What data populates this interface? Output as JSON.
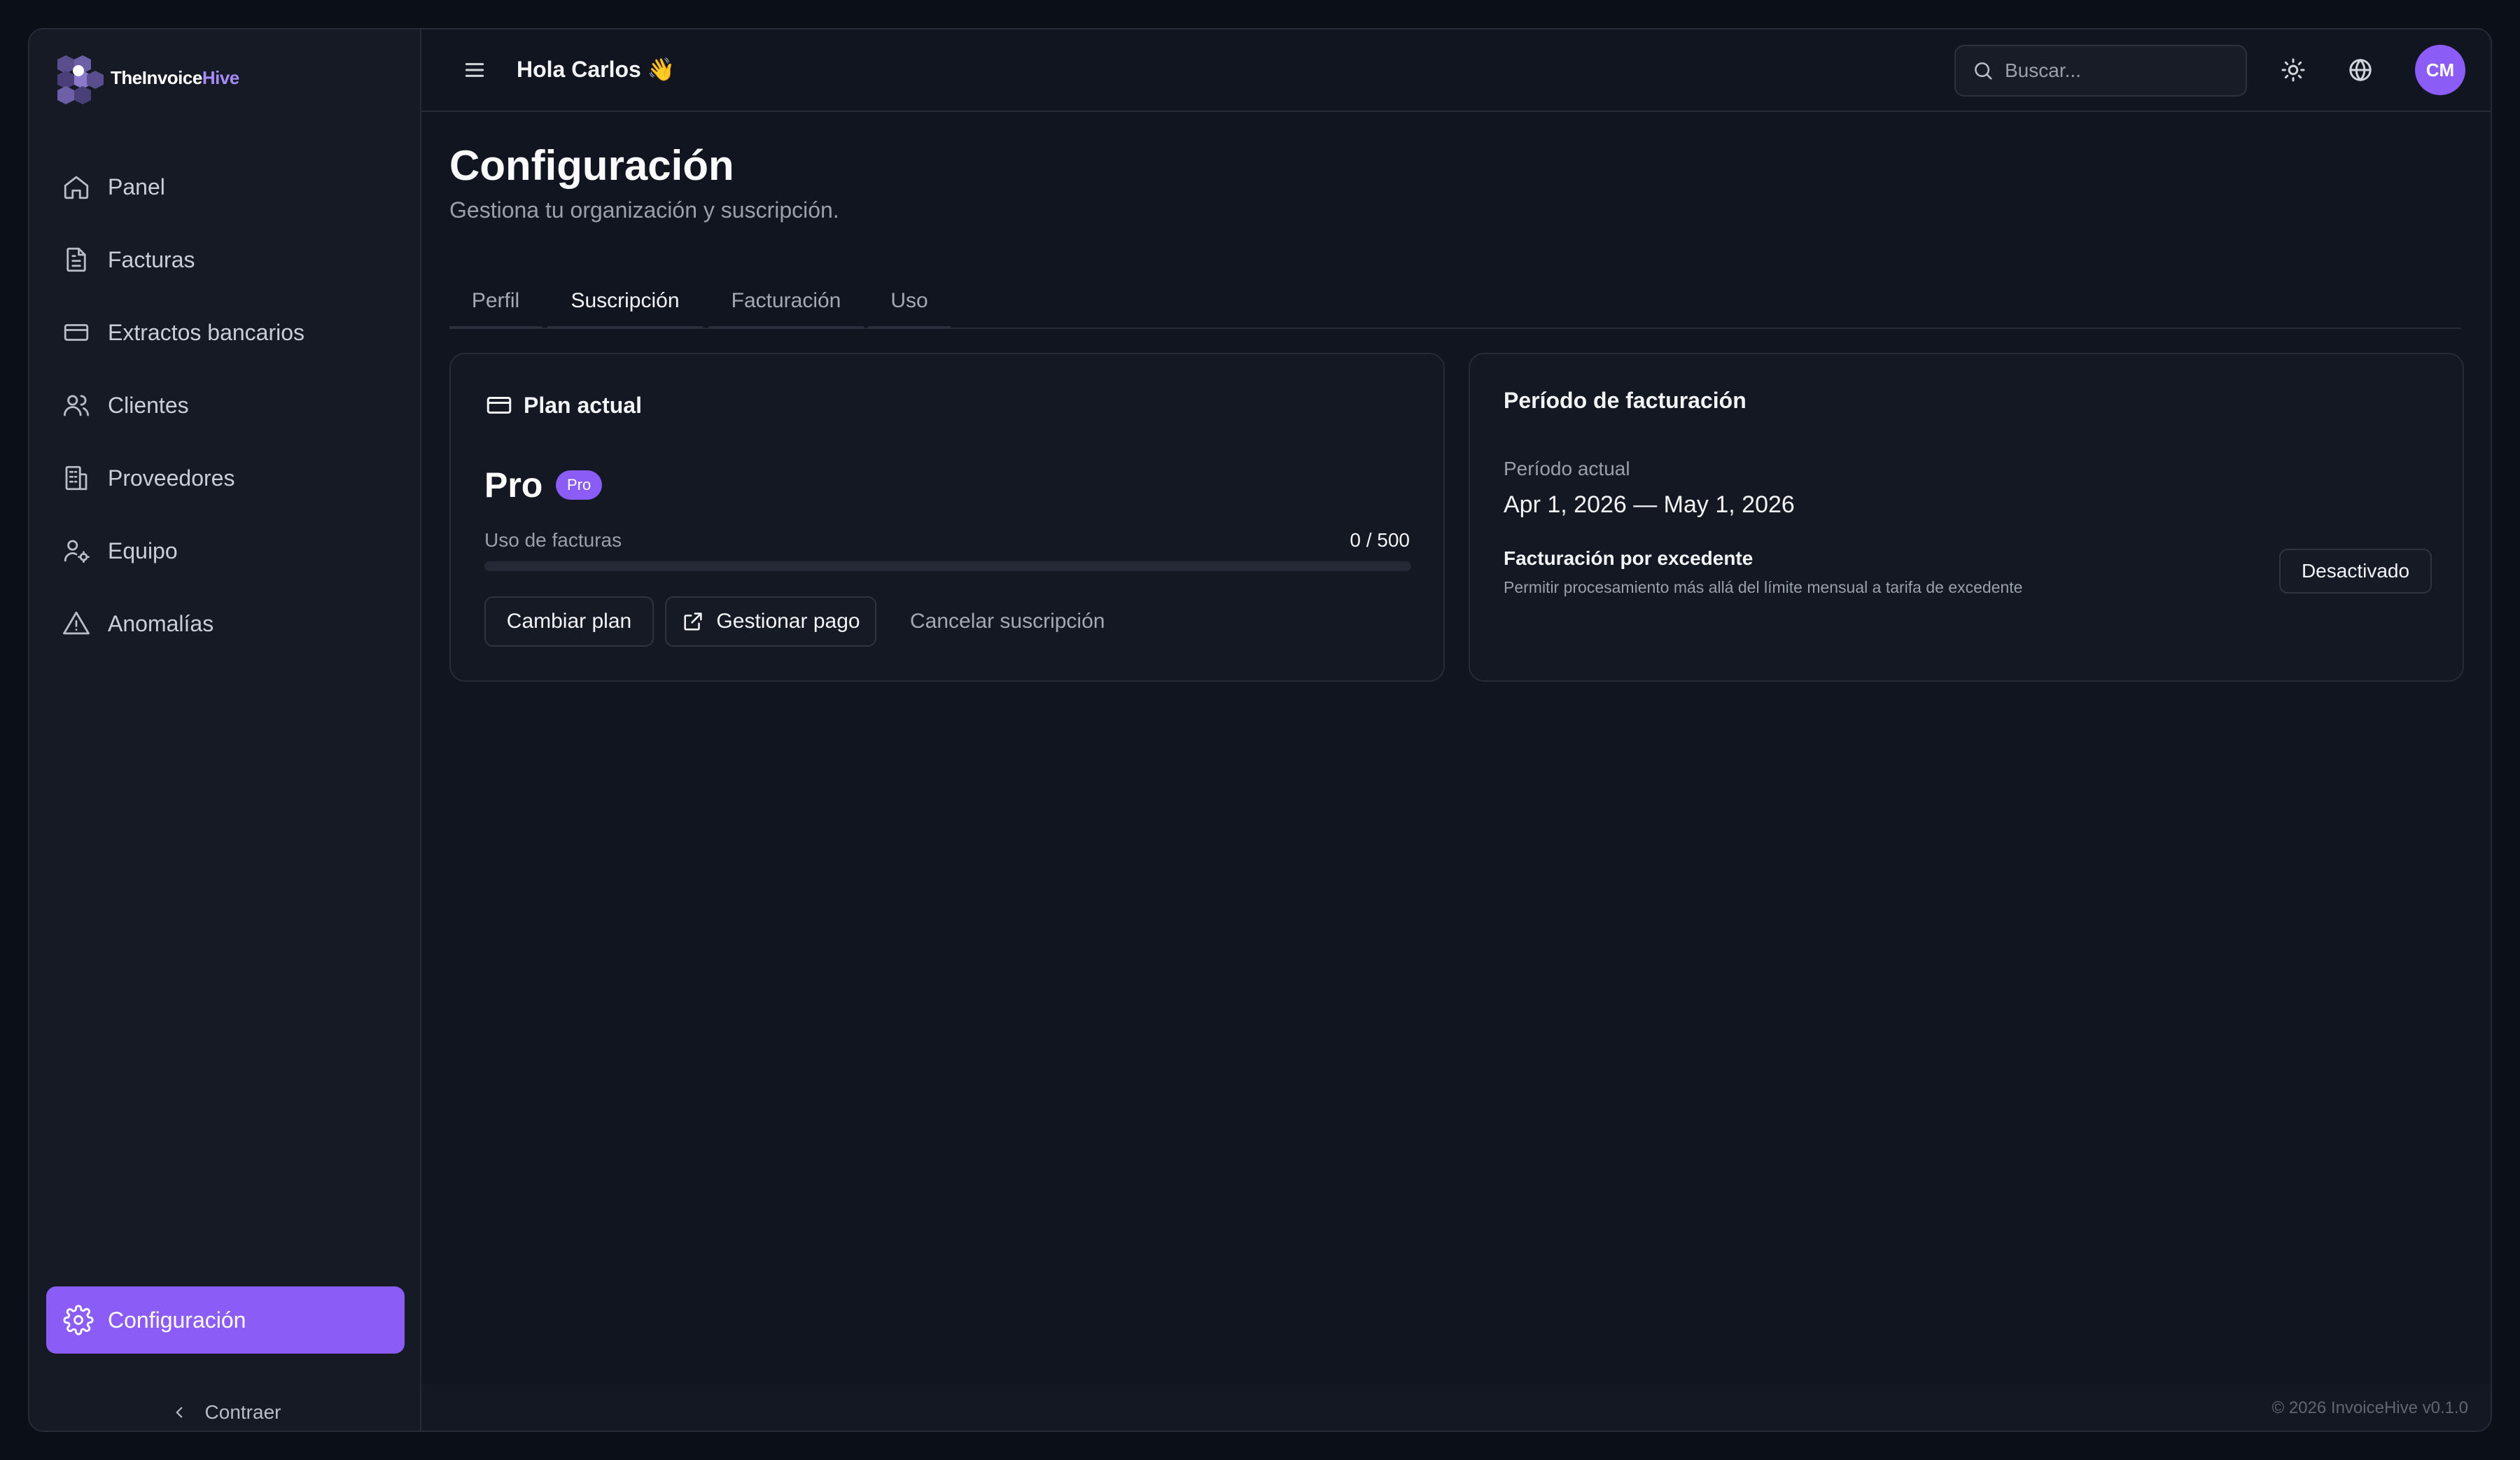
{
  "app": {
    "logo": {
      "prefix": "TheInvoice",
      "accent": "Hive"
    }
  },
  "sidebar": {
    "items": [
      {
        "label": "Panel",
        "icon": "home-icon"
      },
      {
        "label": "Facturas",
        "icon": "file-text-icon"
      },
      {
        "label": "Extractos bancarios",
        "icon": "credit-card-icon"
      },
      {
        "label": "Clientes",
        "icon": "users-icon"
      },
      {
        "label": "Proveedores",
        "icon": "building-icon"
      },
      {
        "label": "Equipo",
        "icon": "user-cog-icon"
      },
      {
        "label": "Anomalías",
        "icon": "alert-triangle-icon"
      }
    ],
    "active_item": {
      "label": "Configuración",
      "icon": "gear-icon"
    },
    "collapse_label": "Contraer"
  },
  "header": {
    "greeting": "Hola Carlos 👋",
    "search_placeholder": "Buscar...",
    "avatar_initials": "CM"
  },
  "page": {
    "title": "Configuración",
    "subtitle": "Gestiona tu organización y suscripción.",
    "tabs": [
      "Perfil",
      "Suscripción",
      "Facturación",
      "Uso"
    ],
    "active_tab": "Suscripción"
  },
  "plan_card": {
    "title": "Plan actual",
    "plan_name": "Pro",
    "plan_badge": "Pro",
    "usage_label": "Uso de facturas",
    "usage_value": "0 / 500",
    "usage_fraction": 0,
    "change_plan": "Cambiar plan",
    "manage_payment": "Gestionar pago",
    "cancel": "Cancelar suscripción"
  },
  "billing_card": {
    "title": "Período de facturación",
    "current_period_label": "Período actual",
    "current_period_value": "Apr 1, 2026 — May 1, 2026",
    "overage_title": "Facturación por excedente",
    "overage_desc": "Permitir procesamiento más allá del límite mensual a tarifa de excedente",
    "overage_status": "Desactivado"
  },
  "footer": {
    "text": "© 2026 InvoiceHive v0.1.0"
  },
  "colors": {
    "accent": "#8b5cf6",
    "background": "#111520"
  }
}
